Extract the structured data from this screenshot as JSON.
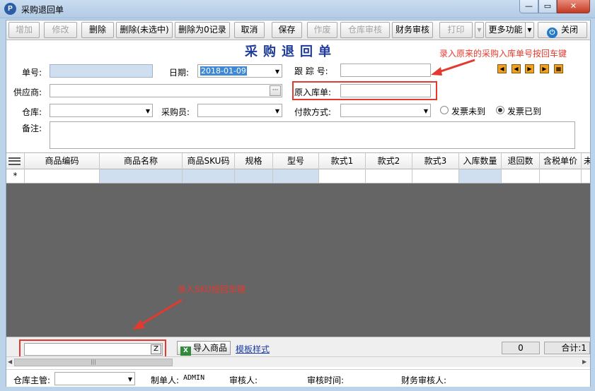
{
  "window": {
    "title": "采购退回单",
    "app_icon_glyph": "P",
    "min_glyph": "—",
    "max_glyph": "▭",
    "close_glyph": "✕"
  },
  "toolbar": {
    "add": "增加",
    "edit": "修改",
    "delete": "删除",
    "delete_unselected": "删除(未选中)",
    "delete_zero": "删除为0记录",
    "cancel": "取消",
    "save": "保存",
    "void": "作废",
    "warehouse_audit": "仓库审核",
    "finance_audit": "财务审核",
    "print": "打印",
    "more": "更多功能",
    "close": "关闭"
  },
  "form": {
    "title": "采购退回单",
    "order_no_label": "单号:",
    "order_no_value": "",
    "date_label": "日期:",
    "date_value": "2018-01-09",
    "tracking_no_label": "跟 踪 号:",
    "tracking_no_value": "",
    "supplier_label": "供应商:",
    "supplier_value": "",
    "original_receipt_label": "原入库单:",
    "original_receipt_value": "",
    "warehouse_label": "仓库:",
    "warehouse_value": "",
    "buyer_label": "采购员:",
    "buyer_value": "",
    "payment_label": "付款方式:",
    "payment_value": "",
    "invoice_not_arrived": "发票未到",
    "invoice_arrived": "发票已到",
    "invoice_status": "arrived",
    "remark_label": "备注:",
    "remark_value": ""
  },
  "annotations": {
    "top": "录入原来的采购入库单号按回车键",
    "bottom": "录入SKU按回车键",
    "color": "#e23a2e"
  },
  "grid": {
    "columns": [
      "商品编码",
      "商品名称",
      "商品SKU码",
      "规格",
      "型号",
      "款式1",
      "款式2",
      "款式3",
      "入库数量",
      "退回数",
      "含税单价",
      "未"
    ],
    "new_row_marker": "*"
  },
  "footer": {
    "sku_input_value": "",
    "z_button": "Z",
    "import_button": "导入商品",
    "template_link": "模板样式",
    "count": "0",
    "total": "合计:1"
  },
  "bottom": {
    "warehouse_manager_label": "仓库主管:",
    "warehouse_manager_value": "",
    "maker_label": "制单人:",
    "maker_value": "ADMIN",
    "reviewer_label": "审核人:",
    "reviewer_value": "",
    "review_time_label": "审核时间:",
    "review_time_value": "",
    "finance_reviewer_label": "财务审核人:",
    "finance_reviewer_value": ""
  },
  "icons": {
    "dropdown": "▼",
    "ellipsis": "···",
    "scroll_left": "◀",
    "scroll_right": "▶",
    "nav_first": "◀",
    "nav_prev": "◀",
    "nav_next": "▶",
    "nav_last": "▶",
    "nav_grid": "▦",
    "power": "⏻",
    "excel": "X",
    "scroll_grip": "|||"
  }
}
